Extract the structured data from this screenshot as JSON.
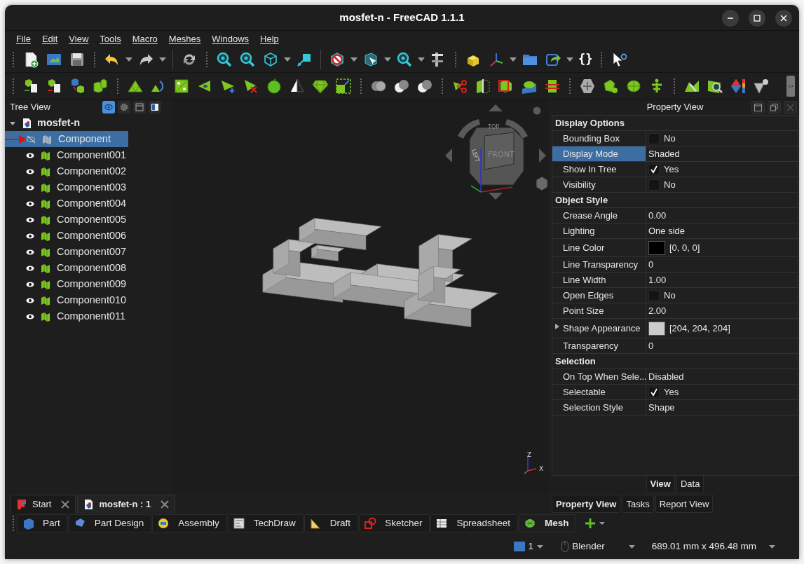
{
  "window": {
    "title": "mosfet-n - FreeCAD 1.1.1"
  },
  "menu": [
    "File",
    "Edit",
    "View",
    "Tools",
    "Macro",
    "Meshes",
    "Windows",
    "Help"
  ],
  "toolbar": {
    "macro_label": "{}"
  },
  "tree_view": {
    "title": "Tree View",
    "document": {
      "label": "mosfet-n",
      "expanded": true,
      "children": [
        {
          "label": "Component",
          "visible": false,
          "selected": true
        },
        {
          "label": "Component001",
          "visible": true,
          "selected": false
        },
        {
          "label": "Component002",
          "visible": true,
          "selected": false
        },
        {
          "label": "Component003",
          "visible": true,
          "selected": false
        },
        {
          "label": "Component004",
          "visible": true,
          "selected": false
        },
        {
          "label": "Component005",
          "visible": true,
          "selected": false
        },
        {
          "label": "Component006",
          "visible": true,
          "selected": false
        },
        {
          "label": "Component007",
          "visible": true,
          "selected": false
        },
        {
          "label": "Component008",
          "visible": true,
          "selected": false
        },
        {
          "label": "Component009",
          "visible": true,
          "selected": false
        },
        {
          "label": "Component010",
          "visible": true,
          "selected": false
        },
        {
          "label": "Component011",
          "visible": true,
          "selected": false
        }
      ]
    }
  },
  "viewport": {
    "nav_cube_faces": [
      "TOP",
      "LEFT",
      "FRONT"
    ],
    "axes": [
      "Z",
      "X"
    ]
  },
  "property_view": {
    "title": "Property View",
    "groups": [
      {
        "name": "Display Options",
        "properties": [
          {
            "name": "Bounding Box",
            "kind": "check",
            "checked": false,
            "value": "No",
            "selected": false
          },
          {
            "name": "Display Mode",
            "kind": "text",
            "value": "Shaded",
            "selected": true
          },
          {
            "name": "Show In Tree",
            "kind": "check",
            "checked": true,
            "value": "Yes",
            "selected": false
          },
          {
            "name": "Visibility",
            "kind": "check",
            "checked": false,
            "value": "No",
            "selected": false
          }
        ]
      },
      {
        "name": "Object Style",
        "properties": [
          {
            "name": "Crease Angle",
            "kind": "text",
            "value": "0.00",
            "selected": false
          },
          {
            "name": "Lighting",
            "kind": "text",
            "value": "One side",
            "selected": false
          },
          {
            "name": "Line Color",
            "kind": "color",
            "color": "#000000",
            "value": "[0, 0, 0]",
            "selected": false
          },
          {
            "name": "Line Transparency",
            "kind": "text",
            "value": "0",
            "selected": false
          },
          {
            "name": "Line Width",
            "kind": "text",
            "value": "1.00",
            "selected": false
          },
          {
            "name": "Open Edges",
            "kind": "check",
            "checked": false,
            "value": "No",
            "selected": false
          },
          {
            "name": "Point Size",
            "kind": "text",
            "value": "2.00",
            "selected": false
          },
          {
            "name": "Shape Appearance",
            "kind": "appearance",
            "color": "#cccccc",
            "value": "[204, 204, 204]",
            "selected": false
          },
          {
            "name": "Transparency",
            "kind": "text",
            "value": "0",
            "selected": false
          }
        ]
      },
      {
        "name": "Selection",
        "properties": [
          {
            "name": "On Top When Sele...",
            "kind": "text",
            "value": "Disabled",
            "selected": false
          },
          {
            "name": "Selectable",
            "kind": "check",
            "checked": true,
            "value": "Yes",
            "selected": false
          },
          {
            "name": "Selection Style",
            "kind": "text",
            "value": "Shape",
            "selected": false
          }
        ]
      }
    ]
  },
  "property_tabs": [
    {
      "label": "View",
      "selected": true
    },
    {
      "label": "Data",
      "selected": false
    }
  ],
  "panel_tabs": [
    {
      "label": "Property View",
      "selected": true
    },
    {
      "label": "Tasks",
      "selected": false
    },
    {
      "label": "Report View",
      "selected": false
    }
  ],
  "document_tabs": [
    {
      "label": "Start",
      "selected": false
    },
    {
      "label": "mosfet-n : 1",
      "selected": true
    }
  ],
  "workbenches": [
    {
      "label": "Part",
      "selected": false
    },
    {
      "label": "Part Design",
      "selected": false
    },
    {
      "label": "Assembly",
      "selected": false
    },
    {
      "label": "TechDraw",
      "selected": false
    },
    {
      "label": "Draft",
      "selected": false
    },
    {
      "label": "Sketcher",
      "selected": false
    },
    {
      "label": "Spreadsheet",
      "selected": false
    },
    {
      "label": "Mesh",
      "selected": true
    }
  ],
  "status_bar": {
    "views": "1",
    "navigation": "Blender",
    "dimensions": "689.01 mm x 496.48 mm"
  }
}
